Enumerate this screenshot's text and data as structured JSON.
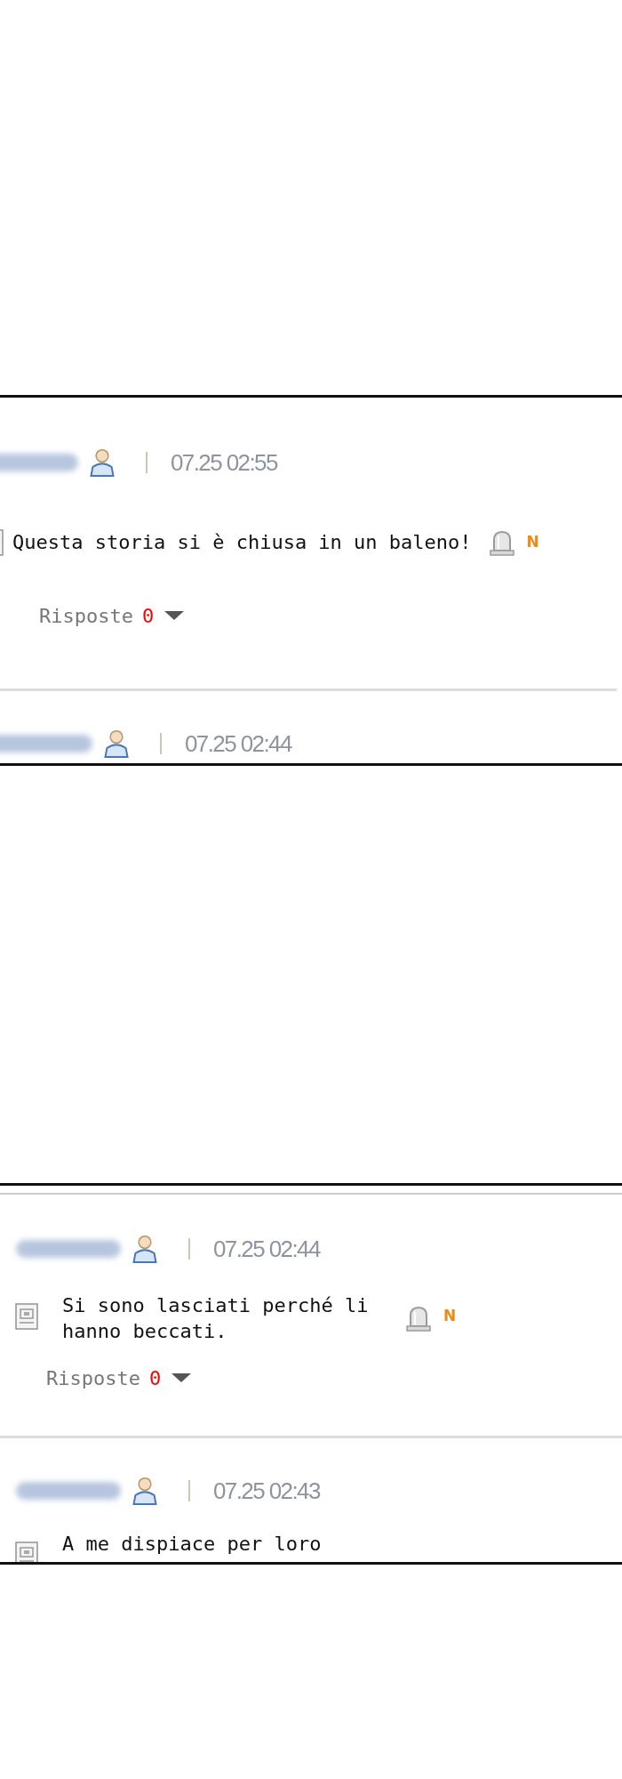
{
  "panels": [
    {
      "comments": [
        {
          "time": "07.25 02:55",
          "text": "Questa storia si è chiusa in un baleno!",
          "new_badge": "N",
          "replies_label": "Risposte",
          "replies_count": "0"
        },
        {
          "time": "07.25 02:44"
        }
      ]
    },
    {
      "comments": [
        {
          "time": "07.25 02:44",
          "text": "Si sono lasciati perché li hanno beccati.",
          "new_badge": "N",
          "replies_label": "Risposte",
          "replies_count": "0"
        },
        {
          "time": "07.25 02:43",
          "text": "A me dispiace per loro"
        }
      ]
    }
  ]
}
